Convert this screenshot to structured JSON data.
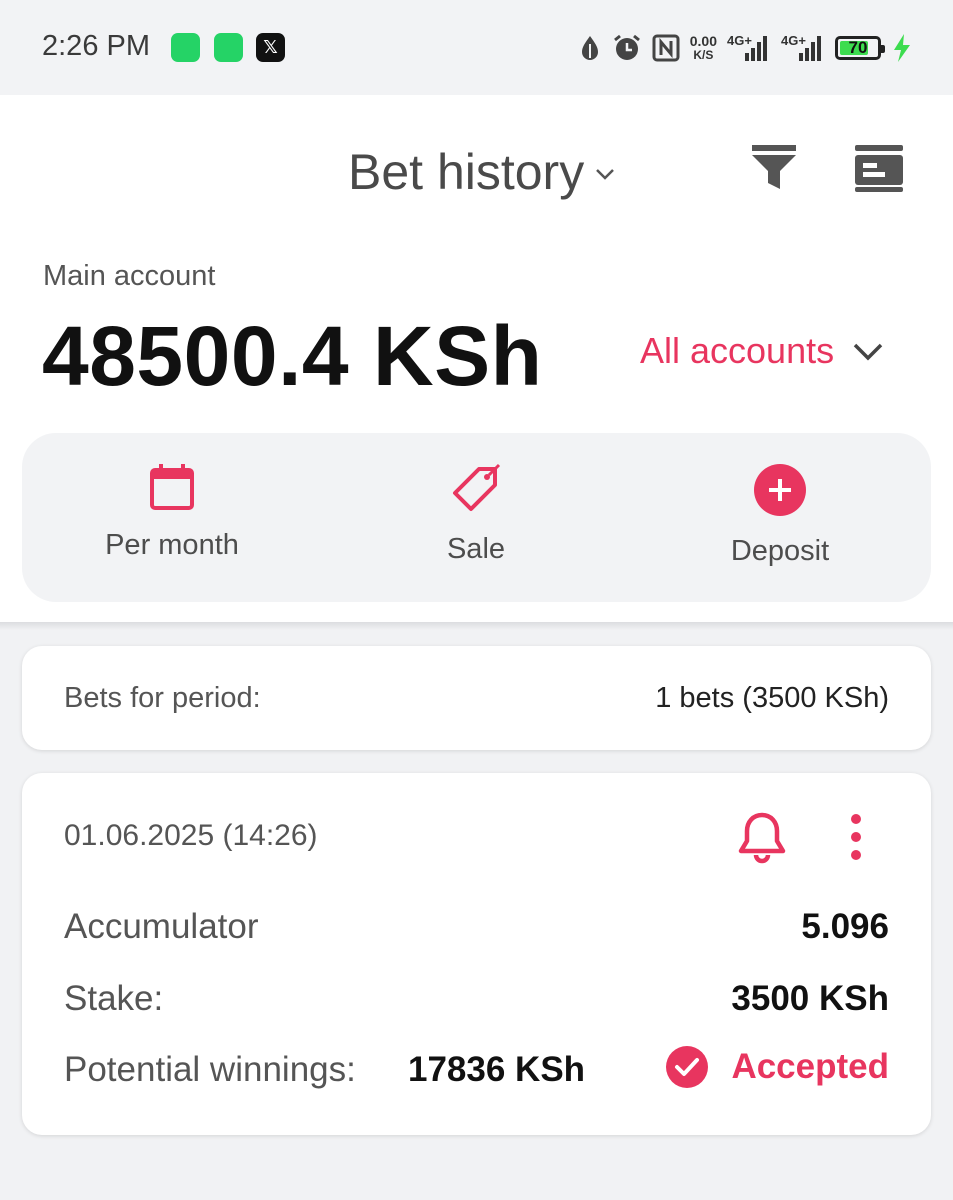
{
  "status_bar": {
    "time": "2:26 PM",
    "apps": [
      "whatsapp-business-icon",
      "whatsapp-icon",
      "x-icon"
    ],
    "speed_value": "0.00",
    "speed_unit": "K/S",
    "net1": "4G+",
    "net2": "4G+",
    "battery": "70"
  },
  "header": {
    "title": "Bet history",
    "account_label": "Main account",
    "balance": "48500.4 KSh",
    "accounts_selector": "All accounts"
  },
  "quick_actions": [
    {
      "label": "Per month",
      "icon": "calendar-icon"
    },
    {
      "label": "Sale",
      "icon": "tag-icon"
    },
    {
      "label": "Deposit",
      "icon": "plus-circle-icon"
    }
  ],
  "summary": {
    "label": "Bets for period:",
    "value": "1 bets (3500 KSh)"
  },
  "bet": {
    "date": "01.06.2025 (14:26)",
    "type_label": "Accumulator",
    "odds": "5.096",
    "stake_label": "Stake:",
    "stake": "3500 KSh",
    "winnings_label": "Potential winnings:",
    "winnings": "17836 KSh",
    "status": "Accepted"
  },
  "colors": {
    "accent": "#e8355f",
    "background": "#f1f2f4",
    "card": "#ffffff"
  }
}
